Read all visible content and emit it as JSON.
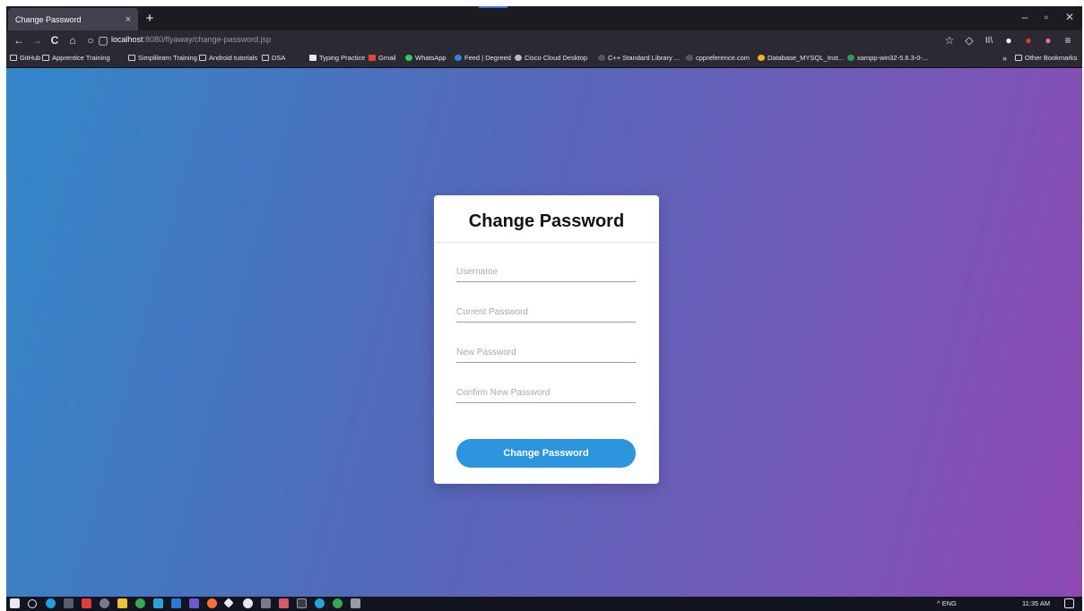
{
  "tab": {
    "title": "Change Password",
    "close": "×",
    "new": "+"
  },
  "window_controls": {
    "minimize": "–",
    "maximize": "▫",
    "close": "✕"
  },
  "nav": {
    "back": "←",
    "forward": "→",
    "reload": "C",
    "home": "⌂",
    "shield": "○",
    "page": "▢",
    "url_host": "localhost",
    "url_path": ":8080/flyaway/change-password.jsp"
  },
  "toolbar_right": {
    "star": "☆",
    "pocket": "◇",
    "library": "II\\",
    "ext1": "●",
    "ext2": "●",
    "ext3": "●",
    "menu": "≡"
  },
  "bookmarks": [
    {
      "label": "GitHub",
      "icon": "folder-icon"
    },
    {
      "label": "Apprentice Training",
      "icon": "folder-icon"
    },
    {
      "label": "Simplilearn Training",
      "icon": "folder-icon"
    },
    {
      "label": "Android tutorials",
      "icon": "folder-icon"
    },
    {
      "label": "DSA",
      "icon": "folder-icon"
    },
    {
      "label": "Typing Practice",
      "icon": "typing-icon"
    },
    {
      "label": "Gmail",
      "icon": "gmail-icon"
    },
    {
      "label": "WhatsApp",
      "icon": "whatsapp-icon"
    },
    {
      "label": "Feed | Degreed",
      "icon": "degreed-icon"
    },
    {
      "label": "Cisco Cloud Desktop",
      "icon": "cisco-icon"
    },
    {
      "label": "C++ Standard Library ...",
      "icon": "globe-icon"
    },
    {
      "label": "cppreference.com",
      "icon": "globe-icon"
    },
    {
      "label": "Database_MYSQL_Inst...",
      "icon": "drive-icon"
    },
    {
      "label": "xampp-win32-5.6.3-0-...",
      "icon": "drive-icon"
    }
  ],
  "bookmarks_overflow": "»",
  "other_bookmarks": "Other Bookmarks",
  "form": {
    "title": "Change Password",
    "username_placeholder": "Username",
    "current_password_placeholder": "Current Password",
    "new_password_placeholder": "New Password",
    "confirm_password_placeholder": "Confirm New Password",
    "submit_label": "Change Password"
  },
  "taskbar": {
    "tray_text": "^  ENG",
    "time": "11:35 AM"
  },
  "colors": {
    "gradient_start": "#3387c9",
    "gradient_end": "#8e48b4",
    "button": "#2d95dd"
  }
}
